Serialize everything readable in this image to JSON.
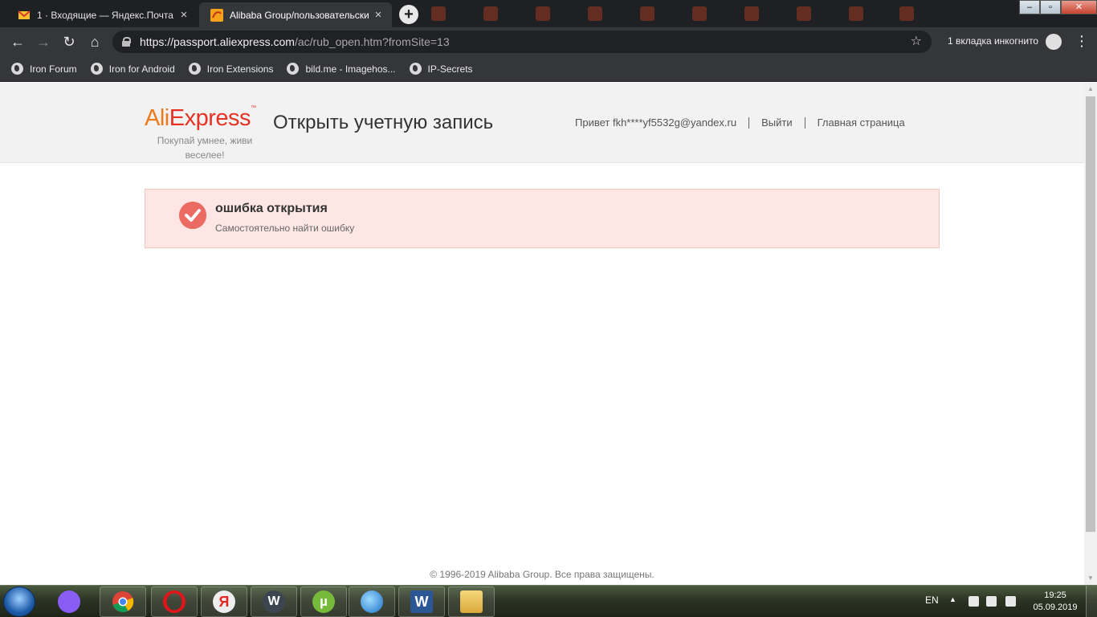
{
  "browser": {
    "tabs": [
      {
        "title": "1 · Входящие — Яндекс.Почта",
        "active": false
      },
      {
        "title": "Alibaba Group/пользовательски",
        "active": true
      }
    ],
    "new_tab_label": "+",
    "close_label": "×",
    "url_host": "https://passport.aliexpress.com",
    "url_path": "/ac/rub_open.htm?fromSite=13",
    "incognito_label": "1 вкладка инкогнито",
    "bookmarks": [
      "Iron Forum",
      "Iron for Android",
      "Iron Extensions",
      "bild.me - Imagehos...",
      "IP-Secrets"
    ]
  },
  "header": {
    "logo_ali": "Ali",
    "logo_express": "Express",
    "logo_tm": "™",
    "tagline": "Покупай умнее, живи веселее!",
    "title": "Открыть учетную запись",
    "greeting": "Привет fkh****yf5532g@yandex.ru",
    "logout_label": "Выйти",
    "home_label": "Главная страница"
  },
  "alert": {
    "title": "ошибка открытия",
    "subtitle": "Самостоятельно найти ошибку"
  },
  "footer": {
    "copyright": "© 1996-2019 Alibaba Group. Все права защищены."
  },
  "taskbar": {
    "language": "EN",
    "time": "19:25",
    "date": "05.09.2019",
    "apps": [
      "alice-icon",
      "chrome-icon",
      "opera-icon",
      "yandex-browser-icon",
      "waterfox-icon",
      "utorrent-icon",
      "ie-icon",
      "word-icon",
      "explorer-icon"
    ]
  },
  "colors": {
    "ali_orange": "#ee7a1b",
    "express_red": "#e43225",
    "alert_bg": "#fde6e3",
    "alert_border": "#f7c3bb",
    "alert_icon": "#eb6a62"
  }
}
